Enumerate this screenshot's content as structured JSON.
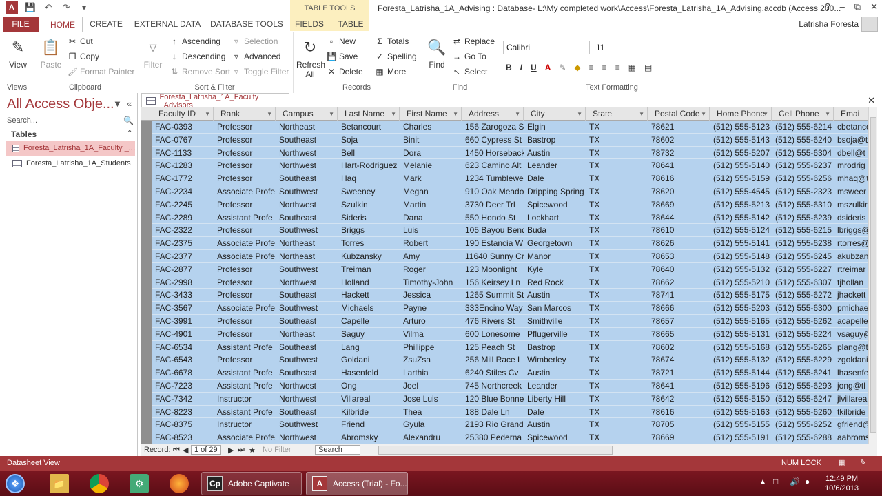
{
  "window": {
    "title": "Foresta_Latrisha_1A_Advising : Database- L:\\My completed work\\Access\\Foresta_Latrisha_1A_Advising.accdb (Access 200...",
    "contextual_label": "TABLE TOOLS",
    "user": "Latrisha Foresta",
    "controls": [
      "?",
      "–",
      "⧉",
      "✕"
    ]
  },
  "tabs": [
    "FILE",
    "HOME",
    "CREATE",
    "EXTERNAL DATA",
    "DATABASE TOOLS",
    "FIELDS",
    "TABLE"
  ],
  "ribbon": {
    "views": {
      "label": "Views",
      "view": "View"
    },
    "clipboard": {
      "label": "Clipboard",
      "paste": "Paste",
      "cut": "Cut",
      "copy": "Copy",
      "format_painter": "Format Painter"
    },
    "sort_filter": {
      "label": "Sort & Filter",
      "filter": "Filter",
      "ascending": "Ascending",
      "descending": "Descending",
      "remove_sort": "Remove Sort",
      "selection": "Selection",
      "advanced": "Advanced",
      "toggle_filter": "Toggle Filter"
    },
    "records": {
      "label": "Records",
      "refresh": "Refresh",
      "refresh2": "All",
      "new": "New",
      "save": "Save",
      "delete": "Delete",
      "totals": "Totals",
      "spelling": "Spelling",
      "more": "More"
    },
    "find": {
      "label": "Find",
      "find": "Find",
      "replace": "Replace",
      "goto": "Go To",
      "select": "Select"
    },
    "text_formatting": {
      "label": "Text Formatting",
      "font": "Calibri",
      "size": "11"
    }
  },
  "nav": {
    "title": "All Access Obje...",
    "search_placeholder": "Search...",
    "group": "Tables",
    "items": [
      "Foresta_Latrisha_1A_Faculty _...",
      "Foresta_Latrisha_1A_Students"
    ]
  },
  "doc_tab": "Foresta_Latrisha_1A_Faculty _Advisors",
  "columns": [
    "Faculty ID",
    "Rank",
    "Campus",
    "Last Name",
    "First Name",
    "Address",
    "City",
    "State",
    "Postal Code",
    "Home Phone",
    "Cell Phone",
    "Emai"
  ],
  "rows": [
    [
      "FAC-0393",
      "Professor",
      "Northeast",
      "Betancourt",
      "Charles",
      "156 Zarogoza St",
      "Elgin",
      "TX",
      "78621",
      "(512) 555-5123",
      "(512) 555-6214",
      "cbetanco"
    ],
    [
      "FAC-0767",
      "Professor",
      "Southeast",
      "Soja",
      "Binit",
      "660 Cypress St",
      "Bastrop",
      "TX",
      "78602",
      "(512) 555-5143",
      "(512) 555-6240",
      "bsoja@t"
    ],
    [
      "FAC-1133",
      "Professor",
      "Northwest",
      "Bell",
      "Dora",
      "1450 Horseback",
      "Austin",
      "TX",
      "78732",
      "(512) 555-5207",
      "(512) 555-6304",
      "dbell@t"
    ],
    [
      "FAC-1283",
      "Professor",
      "Northwest",
      "Hart-Rodriguez",
      "Melanie",
      "623 Camino Alt",
      "Leander",
      "TX",
      "78641",
      "(512) 555-5140",
      "(512) 555-6237",
      "mrodrig"
    ],
    [
      "FAC-1772",
      "Professor",
      "Southeast",
      "Haq",
      "Mark",
      "1234 Tumblewe",
      "Dale",
      "TX",
      "78616",
      "(512) 555-5159",
      "(512) 555-6256",
      "mhaq@t"
    ],
    [
      "FAC-2234",
      "Associate Profe",
      "Southwest",
      "Sweeney",
      "Megan",
      "910 Oak Meado",
      "Dripping Spring",
      "TX",
      "78620",
      "(512) 555-4545",
      "(512) 555-2323",
      "msweer"
    ],
    [
      "FAC-2245",
      "Professor",
      "Northwest",
      "Szulkin",
      "Martin",
      "3730 Deer Trl",
      "Spicewood",
      "TX",
      "78669",
      "(512) 555-5213",
      "(512) 555-6310",
      "mszulkin"
    ],
    [
      "FAC-2289",
      "Assistant Profe",
      "Southeast",
      "Sideris",
      "Dana",
      "550 Hondo St",
      "Lockhart",
      "TX",
      "78644",
      "(512) 555-5142",
      "(512) 555-6239",
      "dsideris"
    ],
    [
      "FAC-2322",
      "Professor",
      "Southwest",
      "Briggs",
      "Luis",
      "105 Bayou Bend",
      "Buda",
      "TX",
      "78610",
      "(512) 555-5124",
      "(512) 555-6215",
      "lbriggs@"
    ],
    [
      "FAC-2375",
      "Associate Profe",
      "Northeast",
      "Torres",
      "Robert",
      "190 Estancia W",
      "Georgetown",
      "TX",
      "78626",
      "(512) 555-5141",
      "(512) 555-6238",
      "rtorres@"
    ],
    [
      "FAC-2377",
      "Associate Profe",
      "Northeast",
      "Kubzansky",
      "Amy",
      "11640 Sunny Cr",
      "Manor",
      "TX",
      "78653",
      "(512) 555-5148",
      "(512) 555-6245",
      "akubzan"
    ],
    [
      "FAC-2877",
      "Professor",
      "Southwest",
      "Treiman",
      "Roger",
      "123 Moonlight",
      "Kyle",
      "TX",
      "78640",
      "(512) 555-5132",
      "(512) 555-6227",
      "rtreimar"
    ],
    [
      "FAC-2998",
      "Professor",
      "Northwest",
      "Holland",
      "Timothy-John",
      "156 Keirsey Ln",
      "Red Rock",
      "TX",
      "78662",
      "(512) 555-5210",
      "(512) 555-6307",
      "tjhollan"
    ],
    [
      "FAC-3433",
      "Professor",
      "Southeast",
      "Hackett",
      "Jessica",
      "1265 Summit St",
      "Austin",
      "TX",
      "78741",
      "(512) 555-5175",
      "(512) 555-6272",
      "jhackett"
    ],
    [
      "FAC-3567",
      "Associate Profe",
      "Southwest",
      "Michaels",
      "Payne",
      "333Encino Way",
      "San Marcos",
      "TX",
      "78666",
      "(512) 555-5203",
      "(512) 555-6300",
      "pmichae"
    ],
    [
      "FAC-3991",
      "Professor",
      "Southeast",
      "Capelle",
      "Arturo",
      "476 Rivers St",
      "Smithville",
      "TX",
      "78657",
      "(512) 555-5165",
      "(512) 555-6262",
      "acapelle"
    ],
    [
      "FAC-4901",
      "Professor",
      "Northeast",
      "Saguy",
      "Vilma",
      "600 Lonesome",
      "Pflugerville",
      "TX",
      "78665",
      "(512) 555-5131",
      "(512) 555-6224",
      "vsaguy@"
    ],
    [
      "FAC-6534",
      "Assistant Profe",
      "Southeast",
      "Lang",
      "Phillippe",
      "125 Peach St",
      "Bastrop",
      "TX",
      "78602",
      "(512) 555-5168",
      "(512) 555-6265",
      "plang@t"
    ],
    [
      "FAC-6543",
      "Professor",
      "Southwest",
      "Goldani",
      "ZsuZsa",
      "256 Mill Race L",
      "Wimberley",
      "TX",
      "78674",
      "(512) 555-5132",
      "(512) 555-6229",
      "zgoldani"
    ],
    [
      "FAC-6678",
      "Assistant Profe",
      "Southeast",
      "Hasenfeld",
      "Larthia",
      "6240 Stiles Cv",
      "Austin",
      "TX",
      "78721",
      "(512) 555-5144",
      "(512) 555-6241",
      "lhasenfe"
    ],
    [
      "FAC-7223",
      "Assistant Profe",
      "Northwest",
      "Ong",
      "Joel",
      "745 Northcreek",
      "Leander",
      "TX",
      "78641",
      "(512) 555-5196",
      "(512) 555-6293",
      "jong@tl"
    ],
    [
      "FAC-7342",
      "Instructor",
      "Northwest",
      "Villareal",
      "Jose Luis",
      "120 Blue Bonne",
      "Liberty Hill",
      "TX",
      "78642",
      "(512) 555-5150",
      "(512) 555-6247",
      "jlvillarea"
    ],
    [
      "FAC-8223",
      "Assistant Profe",
      "Southeast",
      "Kilbride",
      "Thea",
      "188 Dale Ln",
      "Dale",
      "TX",
      "78616",
      "(512) 555-5163",
      "(512) 555-6260",
      "tkilbride"
    ],
    [
      "FAC-8375",
      "Instructor",
      "Southwest",
      "Friend",
      "Gyula",
      "2193 Rio Grand",
      "Austin",
      "TX",
      "78705",
      "(512) 555-5155",
      "(512) 555-6252",
      "gfriend@"
    ],
    [
      "FAC-8523",
      "Associate Profe",
      "Northwest",
      "Abromsky",
      "Alexandru",
      "25380 Pederna",
      "Spicewood",
      "TX",
      "78669",
      "(512) 555-5191",
      "(512) 555-6288",
      "aabroms"
    ]
  ],
  "record_nav": {
    "label": "Record:",
    "current": "1 of 29",
    "filter": "No Filter",
    "search": "Search"
  },
  "status": {
    "left": "Datasheet View",
    "numlock": "NUM LOCK"
  },
  "taskbar": {
    "captivate": "Adobe Captivate",
    "access": "Access (Trial) - Fo...",
    "time": "12:49 PM",
    "date": "10/6/2013"
  },
  "colors": {
    "accent": "#a4373a",
    "selected_row": "#b5d2ee",
    "taskbar": "#6e1019"
  }
}
